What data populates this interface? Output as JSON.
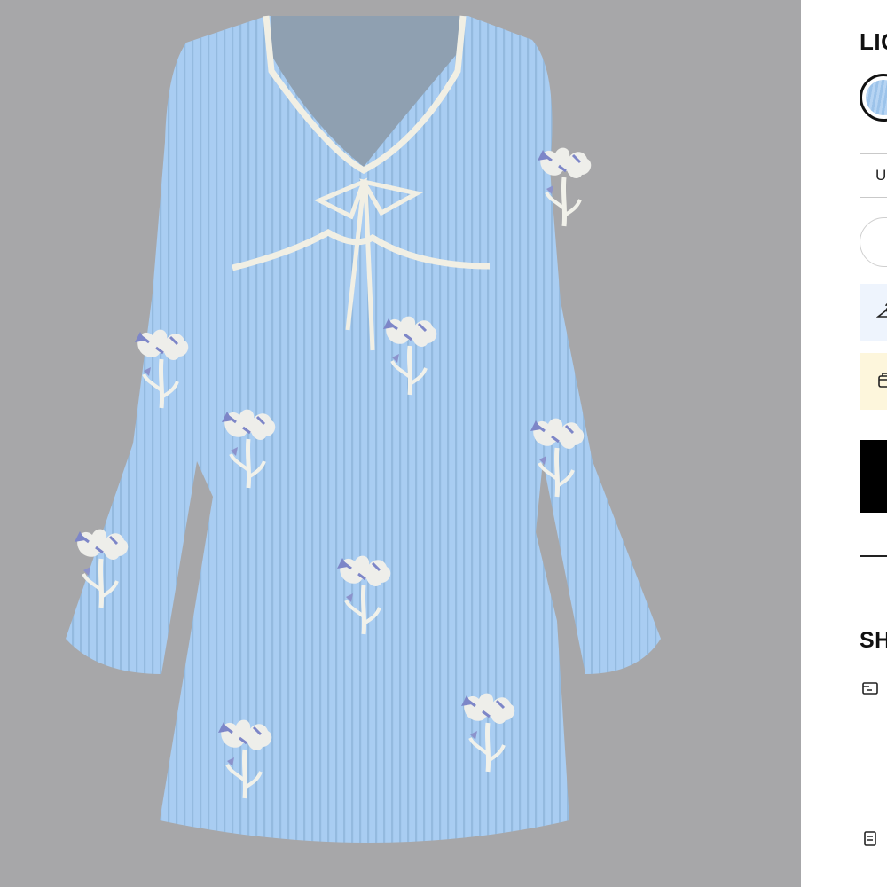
{
  "gallery": {
    "image_description_name": "product-image",
    "background_color": "#a7a7a9",
    "dress_color": "#a9cdf2"
  },
  "panel": {
    "color_label": "LIG",
    "size_select_value": "U",
    "icons": {
      "hanger": "hanger-icon",
      "box": "package-icon",
      "shipping": "shipping-card-icon",
      "returns": "clipboard-icon"
    },
    "section_title": "SH",
    "colors": {
      "button": "#000000",
      "banner_blue": "#eef4fd",
      "banner_yellow": "#fdf6dc"
    }
  }
}
